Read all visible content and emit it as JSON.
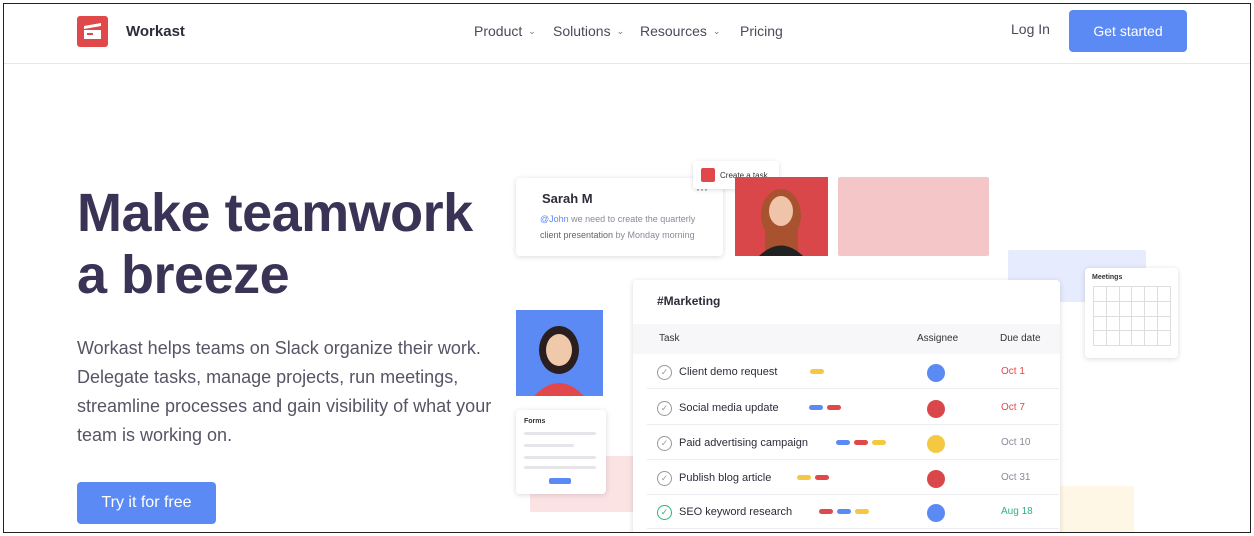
{
  "brand": {
    "name": "Workast"
  },
  "nav": {
    "items": [
      {
        "label": "Product",
        "has_dropdown": true
      },
      {
        "label": "Solutions",
        "has_dropdown": true
      },
      {
        "label": "Resources",
        "has_dropdown": true
      },
      {
        "label": "Pricing",
        "has_dropdown": false
      }
    ],
    "login": "Log In",
    "get_started": "Get started"
  },
  "hero": {
    "title_line1": "Make teamwork",
    "title_line2": "a breeze",
    "subtitle": "Workast helps teams on Slack organize their work. Delegate tasks, manage projects, run meetings, streamline processes and gain visibility of what your team is working on.",
    "cta": "Try it for free"
  },
  "illustration": {
    "message": {
      "author": "Sarah M",
      "mention": "@John",
      "text_a": " we need to create the quarterly",
      "bold": "client presentation",
      "text_b": " by Monday morning",
      "menu": "···"
    },
    "create_task": "Create a task",
    "table": {
      "channel": "#Marketing",
      "headers": {
        "task": "Task",
        "assignee": "Assignee",
        "due": "Due date"
      },
      "rows": [
        {
          "task": "Client demo request",
          "due": "Oct 1",
          "due_color": "#e0484a",
          "done": false,
          "tags": [
            "#f5c842"
          ]
        },
        {
          "task": "Social media update",
          "due": "Oct 7",
          "due_color": "#e0484a",
          "done": false,
          "tags": [
            "#5b8af5",
            "#e0484a"
          ]
        },
        {
          "task": "Paid advertising campaign",
          "due": "Oct 10",
          "due_color": "#8a8a99",
          "done": false,
          "tags": [
            "#5b8af5",
            "#e0484a",
            "#f5c842"
          ]
        },
        {
          "task": "Publish blog article",
          "due": "Oct 31",
          "due_color": "#8a8a99",
          "done": false,
          "tags": [
            "#f5c842",
            "#e0484a"
          ]
        },
        {
          "task": "SEO keyword research",
          "due": "Aug 18",
          "due_color": "#2db37a",
          "done": true,
          "tags": [
            "#e0484a",
            "#5b8af5",
            "#f5c842"
          ]
        }
      ]
    },
    "meetings_title": "Meetings",
    "forms_title": "Forms"
  },
  "colors": {
    "accent": "#5b8af5",
    "brand": "#e0484a",
    "heading": "#3b3355"
  }
}
